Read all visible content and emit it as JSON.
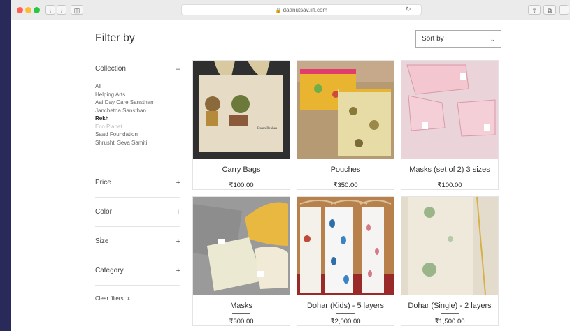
{
  "browser": {
    "url": "daanutsav.iifl.com",
    "lock_icon": "lock-icon",
    "reload_icon": "reload-icon",
    "traffic_lights": [
      "#ff5f57",
      "#febc2e",
      "#28c840"
    ]
  },
  "filter": {
    "title": "Filter by",
    "collection": {
      "label": "Collection",
      "toggle": "–",
      "items": [
        "All",
        "Helping Arts",
        "Aai Day Care Sansthan",
        "Janchetna Sansthan",
        "Rekh",
        "Eco Planet",
        "Saad Foundation",
        "Shrushti Seva Samiti."
      ],
      "selected": "Rekh"
    },
    "sections": [
      {
        "label": "Price",
        "toggle": "+"
      },
      {
        "label": "Color",
        "toggle": "+"
      },
      {
        "label": "Size",
        "toggle": "+"
      },
      {
        "label": "Category",
        "toggle": "+"
      }
    ],
    "clear_label": "Clear filters",
    "clear_icon": "x"
  },
  "sort": {
    "label": "Sort by"
  },
  "products": [
    {
      "name": "Carry Bags",
      "price": "₹100.00"
    },
    {
      "name": "Pouches",
      "price": "₹350.00"
    },
    {
      "name": "Masks (set of 2) 3 sizes",
      "price": "₹100.00"
    },
    {
      "name": "Masks",
      "price": "₹300.00"
    },
    {
      "name": "Dohar (Kids) - 5 layers",
      "price": "₹2,000.00"
    },
    {
      "name": "Dohar (Single) - 2 layers",
      "price": "₹1,500.00"
    }
  ]
}
